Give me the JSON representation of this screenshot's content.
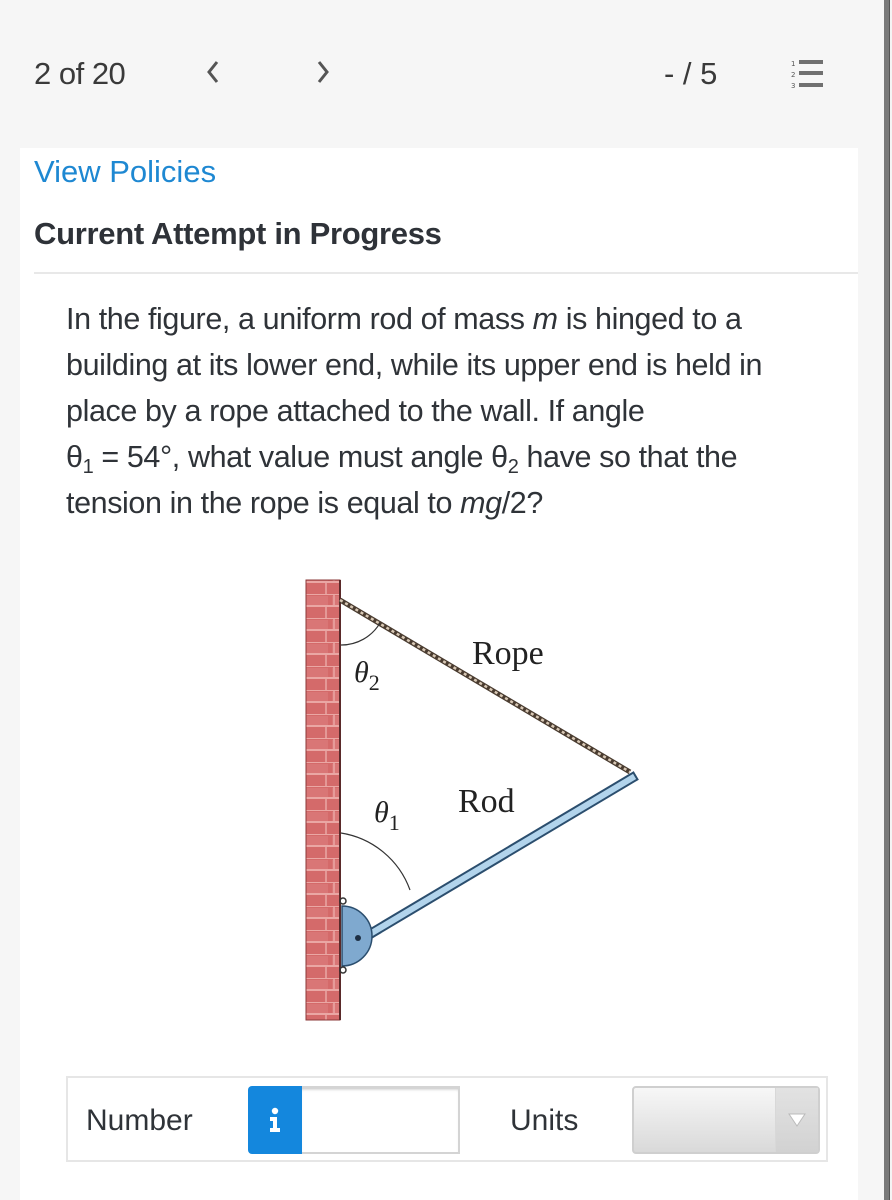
{
  "header": {
    "question_counter": "2 of 20",
    "prev_label": "<",
    "next_label": ">",
    "score": "- / 5",
    "list_icon": "numbered-list-icon"
  },
  "card": {
    "view_policies_link": "View Policies",
    "attempt_title": "Current Attempt in Progress"
  },
  "question": {
    "line1_a": "In the figure, a uniform rod of mass ",
    "line1_m": "m",
    "line1_b": " is hinged to a building at its lower end, while its upper end is held in place by a rope attached to the wall. If angle ",
    "theta": "θ",
    "sub1": "1",
    "sub2": "2",
    "given": " = 54°, what value must angle ",
    "rest": " have so that the tension in the rope is equal to ",
    "mg": "mg",
    "tail": "/2?"
  },
  "figure": {
    "rope_label": "Rope",
    "rod_label": "Rod",
    "theta2_label": "θ",
    "theta2_sub": "2",
    "theta1_label": "θ",
    "theta1_sub": "1",
    "colors": {
      "brick": "#d46a6a",
      "mortar": "#f0b3b0",
      "rod": "#a8cde8",
      "hinge": "#7fa9cf"
    }
  },
  "answer": {
    "number_label": "Number",
    "info_icon": "i",
    "number_value": "",
    "number_placeholder": "",
    "units_label": "Units",
    "units_selected": ""
  },
  "colors": {
    "link": "#1e88d2",
    "info_button": "#1487dd",
    "background": "#f6f6f6"
  }
}
